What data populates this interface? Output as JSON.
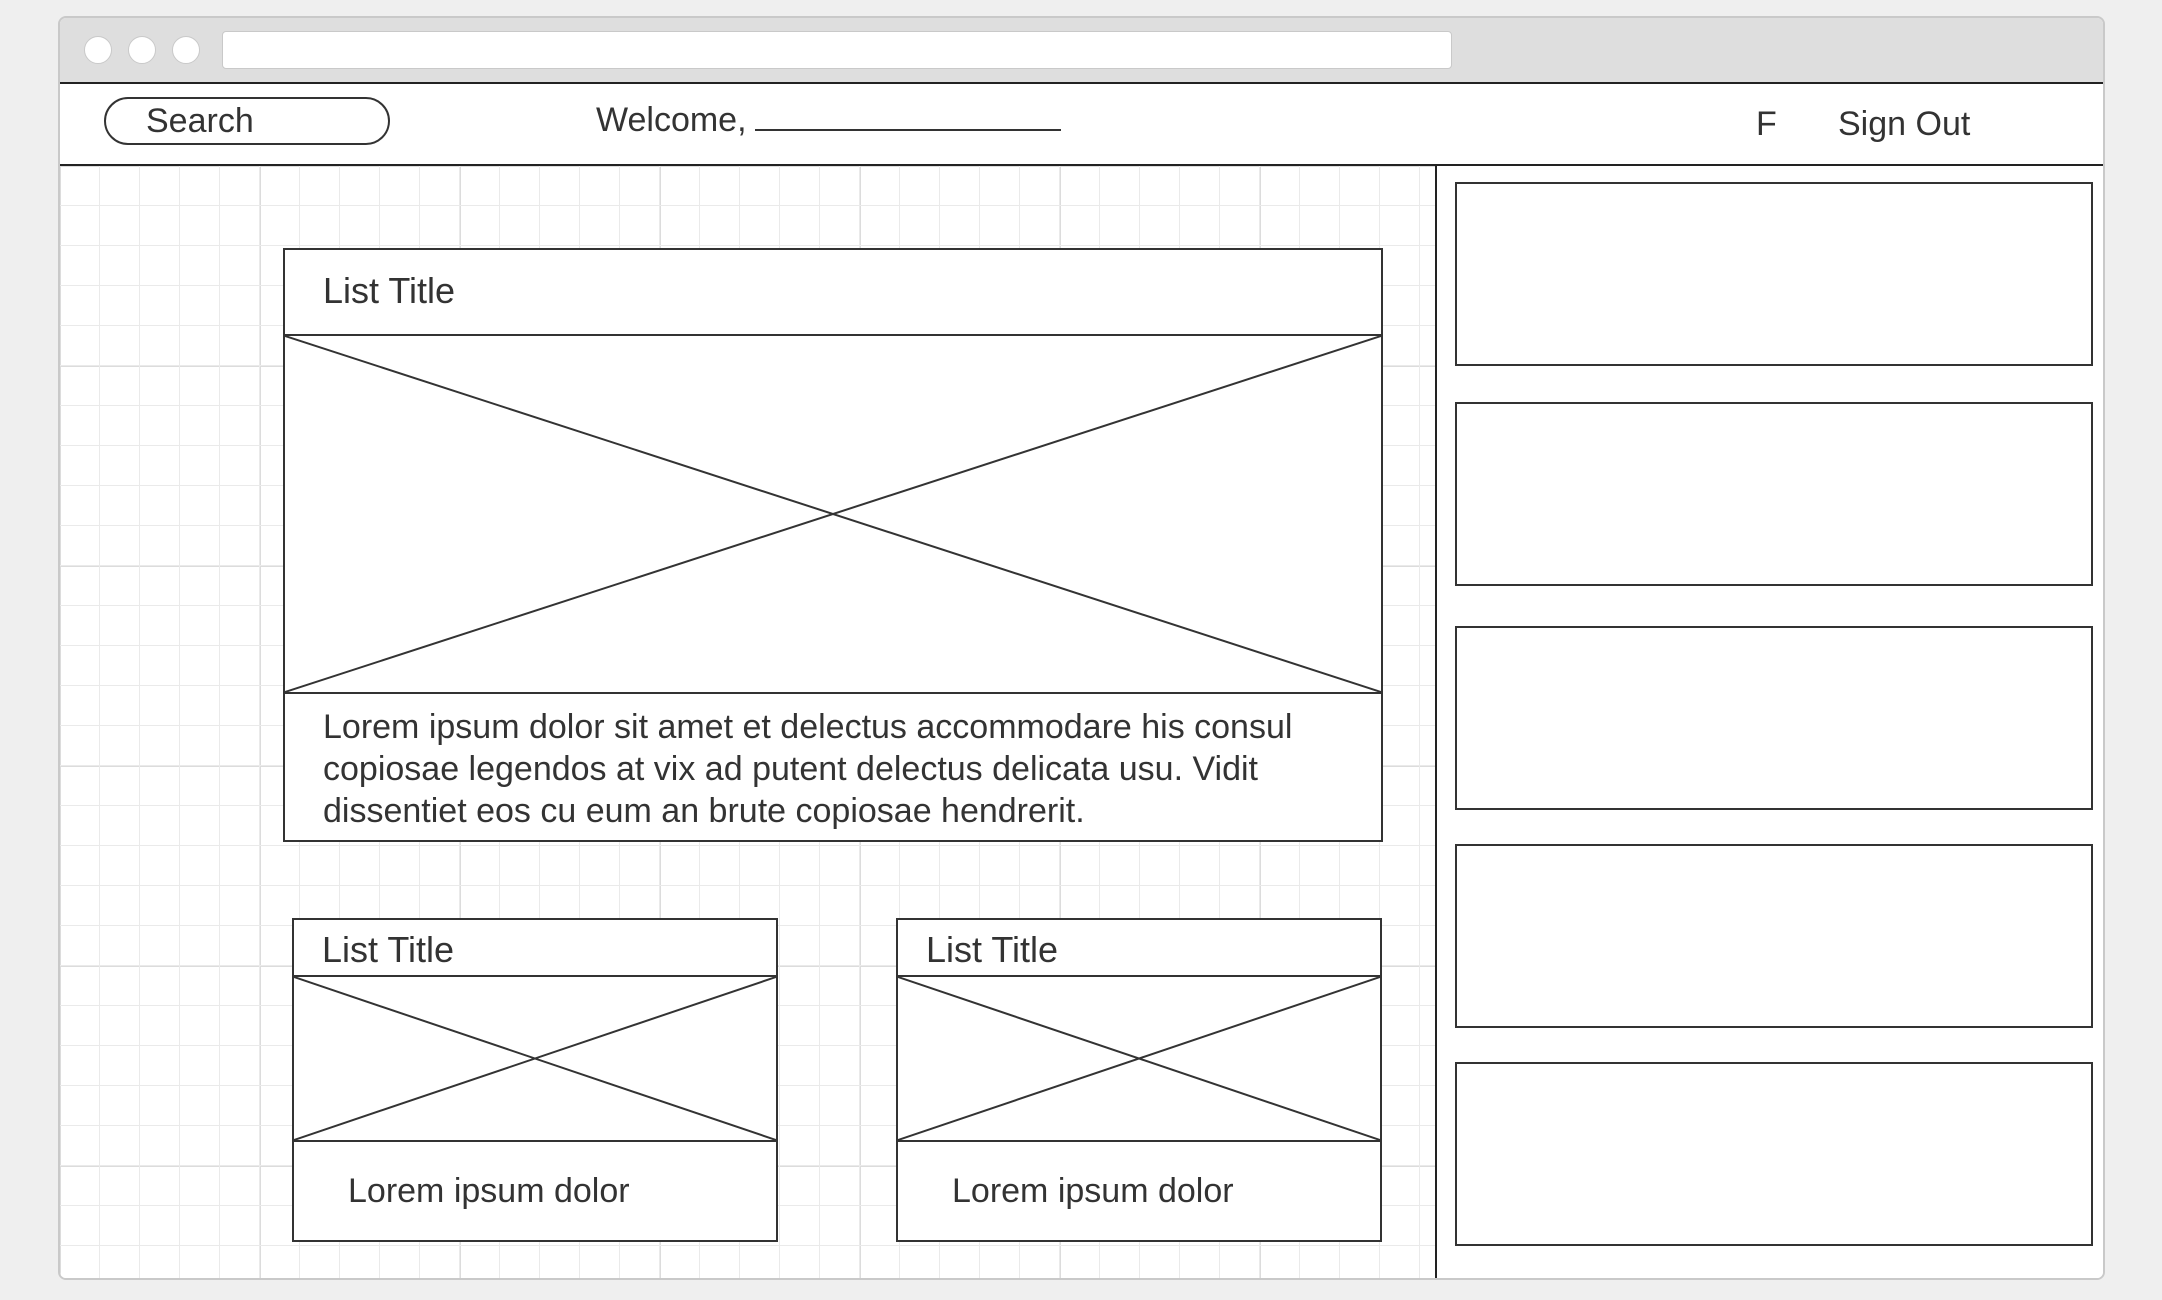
{
  "header": {
    "search_label": "Search",
    "welcome_label": "Welcome,",
    "social_label": "F",
    "signout_label": "Sign Out"
  },
  "main": {
    "cards": [
      {
        "title": "List Title",
        "text": "Lorem ipsum dolor sit amet et delectus accommodare his consul copiosae legendos at vix ad putent delectus delicata usu. Vidit dissentiet eos cu eum an brute copiosae hendrerit."
      },
      {
        "title": "List Title",
        "text": "Lorem ipsum dolor"
      },
      {
        "title": "List Title",
        "text": "Lorem ipsum dolor"
      }
    ]
  },
  "icons": {
    "window_controls": [
      "circle-icon",
      "circle-icon",
      "circle-icon"
    ],
    "image_placeholder": "image-placeholder-icon"
  },
  "colors": {
    "line": "#333333",
    "grid": "#eaeaea",
    "chrome": "#dedede",
    "background": "#efefef"
  }
}
